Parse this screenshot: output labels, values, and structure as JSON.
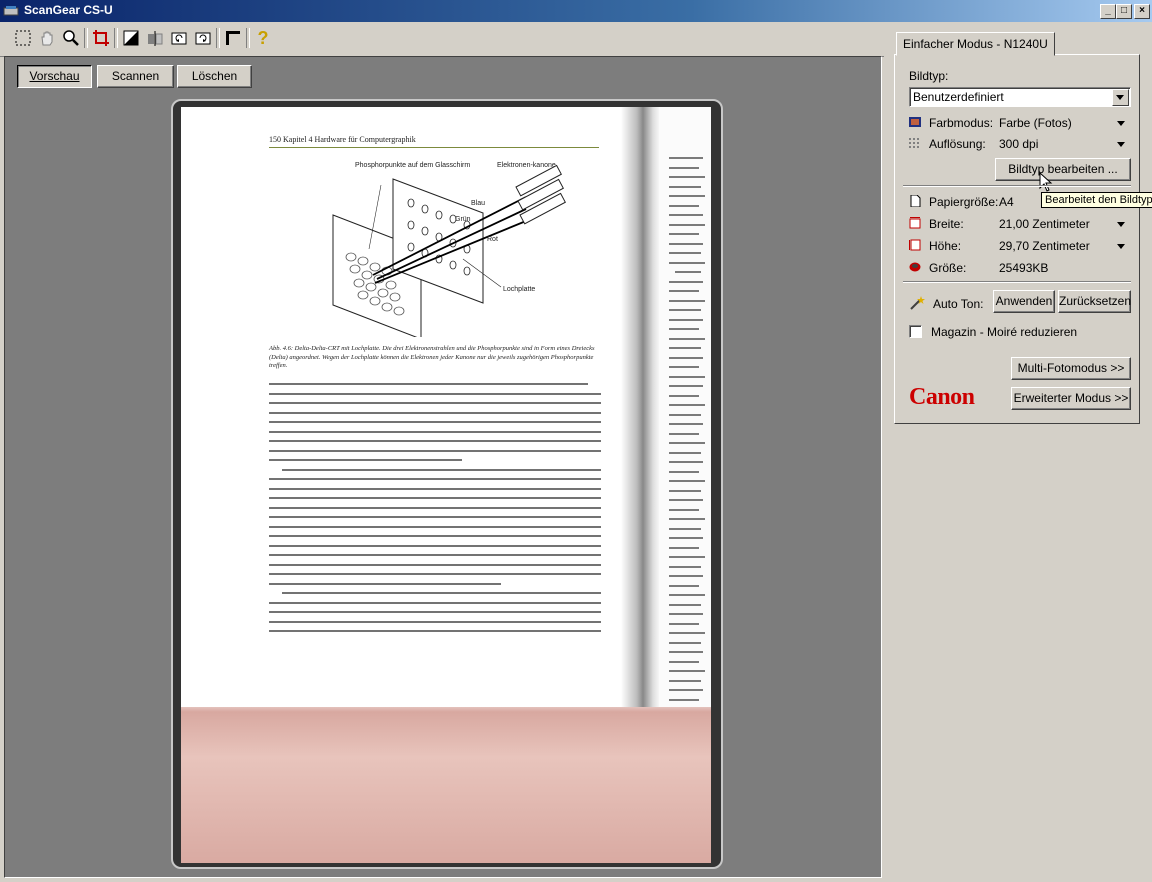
{
  "window": {
    "title": "ScanGear CS-U",
    "minimize": "_",
    "maximize": "□",
    "close": "×"
  },
  "toolbar": {
    "icons": [
      "marquee-select-icon",
      "hand-icon",
      "zoom-icon",
      "crop-icon",
      "invert-icon",
      "mirror-icon",
      "rotate-left-icon",
      "rotate-right-icon",
      "ruler-icon",
      "help-icon"
    ],
    "help_glyph": "?"
  },
  "preview": {
    "preview_button": "Vorschau",
    "scan_button": "Scannen",
    "delete_button": "Löschen"
  },
  "scanned_page": {
    "page_header": "150    Kapitel 4   Hardware für Computergraphik",
    "diagram_labels": {
      "phosphor": "Phosphorpunkte auf dem Glasschirm",
      "guns": "Elektronen-kanone",
      "blue": "Blau",
      "green": "Grün",
      "red": "Rot",
      "mask": "Lochplatte"
    },
    "caption": "Abb. 4.6: Delta-Delta-CRT mit Lochplatte. Die drei Elektronenstrahlen und die Phosphorpunkte sind in Form eines Dreiecks (Delta) angeordnet. Wegen der Lochplatte können die Elektronen jeder Kanone nur die jeweils zugehörigen Phosphorpunkte treffen."
  },
  "panel": {
    "tab_label": "Einfacher Modus - N1240U",
    "image_type_label": "Bildtyp:",
    "image_type_value": "Benutzerdefiniert",
    "color_mode_label": "Farbmodus:",
    "color_mode_value": "Farbe (Fotos)",
    "resolution_label": "Auflösung:",
    "resolution_value": "300 dpi",
    "edit_image_type_button": "Bildtyp bearbeiten ...",
    "tooltip": "Bearbeitet den Bildtyp",
    "paper_size_label": "Papiergröße:",
    "paper_size_value": "A4",
    "width_label": "Breite:",
    "width_value": "21,00 Zentimeter",
    "height_label": "Höhe:",
    "height_value": "29,70 Zentimeter",
    "size_label": "Größe:",
    "size_value": "25493KB",
    "auto_tone_label": "Auto Ton:",
    "apply_button": "Anwenden",
    "reset_button": "Zurücksetzen",
    "moire_label": "Magazin - Moiré reduzieren",
    "multi_photo_button": "Multi-Fotomodus >>",
    "advanced_mode_button": "Erweiterter Modus >>",
    "brand": "Canon"
  },
  "colors": {
    "titlebar_start": "#0a246a",
    "titlebar_end": "#a6caf0",
    "face": "#d4d0c8",
    "preview_bg": "#7d7d7d",
    "brand_red": "#cc0000"
  }
}
